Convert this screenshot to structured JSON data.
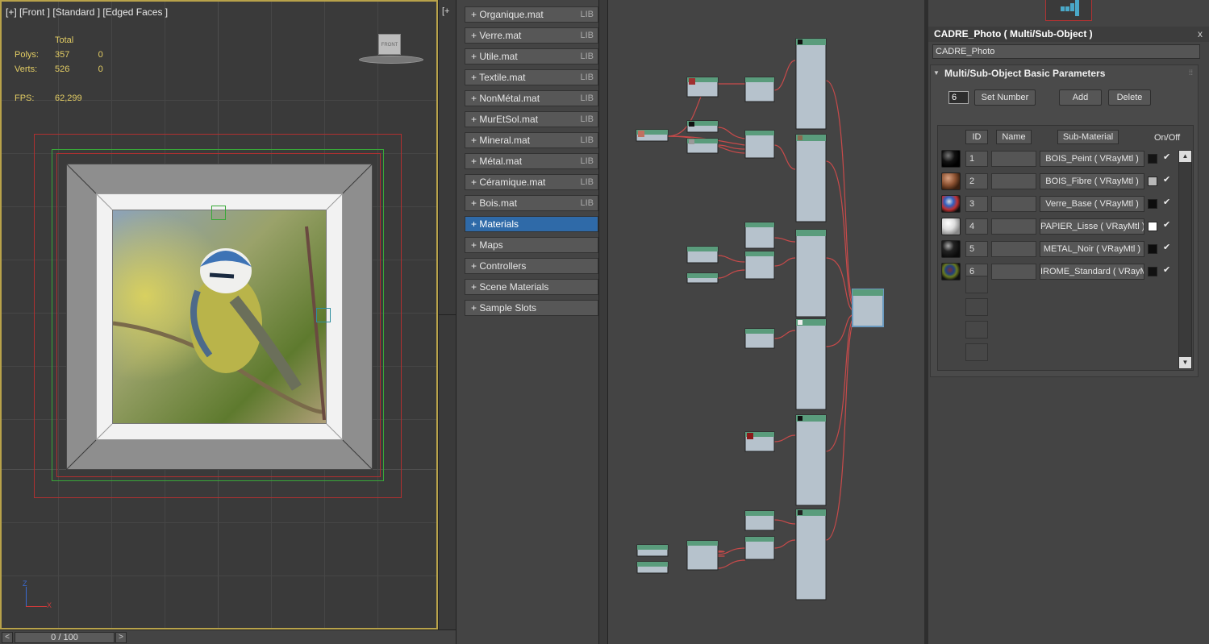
{
  "viewport": {
    "label": "[+] [Front ] [Standard ] [Edged Faces ]",
    "stats": {
      "total_header": "Total",
      "polys_label": "Polys:",
      "polys_total": "357",
      "polys_sel": "0",
      "verts_label": "Verts:",
      "verts_total": "526",
      "verts_sel": "0",
      "fps_label": "FPS:",
      "fps_value": "62,299"
    },
    "navcube_label": "FRONT",
    "axis_z": "Z",
    "axis_x": "X"
  },
  "second_viewport_label": "[+",
  "timeline": {
    "value": "0 / 100",
    "prev": "<",
    "next": ">"
  },
  "material_browser": {
    "items": [
      {
        "label": "+ Organique.mat",
        "tag": "LIB"
      },
      {
        "label": "+ Verre.mat",
        "tag": "LIB"
      },
      {
        "label": "+ Utile.mat",
        "tag": "LIB"
      },
      {
        "label": "+ Textile.mat",
        "tag": "LIB"
      },
      {
        "label": "+ NonMétal.mat",
        "tag": "LIB"
      },
      {
        "label": "+ MurEtSol.mat",
        "tag": "LIB"
      },
      {
        "label": "+ Mineral.mat",
        "tag": "LIB"
      },
      {
        "label": "+ Métal.mat",
        "tag": "LIB"
      },
      {
        "label": "+ Céramique.mat",
        "tag": "LIB"
      },
      {
        "label": "+ Bois.mat",
        "tag": "LIB"
      },
      {
        "label": "+ Materials",
        "tag": ""
      },
      {
        "label": "+ Maps",
        "tag": ""
      },
      {
        "label": "+ Controllers",
        "tag": ""
      },
      {
        "label": "+ Scene Materials",
        "tag": ""
      },
      {
        "label": "+ Sample Slots",
        "tag": ""
      }
    ],
    "selected_index": 10
  },
  "parameters": {
    "title": "CADRE_Photo  ( Multi/Sub-Object )",
    "close": "x",
    "name_field": "CADRE_Photo",
    "rollout_title": "Multi/Sub-Object Basic Parameters",
    "rollout_toggle": "▼",
    "count": "6",
    "set_number": "Set Number",
    "add": "Add",
    "delete": "Delete",
    "columns": {
      "id": "ID",
      "name": "Name",
      "sub_material": "Sub-Material",
      "on_off": "On/Off"
    },
    "rows": [
      {
        "id": "1",
        "sub": "BOIS_Peint  ( VRayMtl )",
        "swatch": "#141414",
        "checked": "✔",
        "thumb": "sphere-black"
      },
      {
        "id": "2",
        "sub": "BOIS_Fibre  ( VRayMtl )",
        "swatch": "#b8b8b8",
        "checked": "✔",
        "thumb": "sphere-wood"
      },
      {
        "id": "3",
        "sub": "Verre_Base  ( VRayMtl )",
        "swatch": "#0d0d0d",
        "checked": "✔",
        "thumb": "sphere-glass"
      },
      {
        "id": "4",
        "sub": "PAPIER_Lisse  ( VRayMtl )",
        "swatch": "#ffffff",
        "checked": "✔",
        "thumb": "sphere-white"
      },
      {
        "id": "5",
        "sub": "METAL_Noir  ( VRayMtl )",
        "swatch": "#0d0d0d",
        "checked": "✔",
        "thumb": "sphere-dark"
      },
      {
        "id": "6",
        "sub": "IROME_Standard  ( VRayMtl )",
        "swatch": "#111111",
        "checked": "✔",
        "thumb": "sphere-chrome"
      }
    ],
    "scroll_up": "▲",
    "scroll_down": "▼"
  }
}
